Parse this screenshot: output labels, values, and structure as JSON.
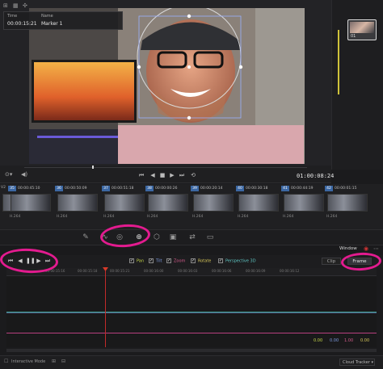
{
  "viewer": {
    "info_time_label": "Time",
    "info_time_value": "00:00:15:21",
    "info_name_label": "Name",
    "info_name_value": "Marker 1",
    "timecode": "01:00:08:24"
  },
  "node": {
    "label": "01"
  },
  "clips": [
    {
      "num": "35",
      "tc": "00:00:45:10",
      "codec": "H.264"
    },
    {
      "num": "36",
      "tc": "00:00:50:09",
      "codec": "H.264"
    },
    {
      "num": "37",
      "tc": "00:00:51:18",
      "codec": "H.264"
    },
    {
      "num": "38",
      "tc": "00:00:00:26",
      "codec": "H.264"
    },
    {
      "num": "39",
      "tc": "00:00:20:14",
      "codec": "H.264"
    },
    {
      "num": "40",
      "tc": "00:00:30:18",
      "codec": "H.264"
    },
    {
      "num": "41",
      "tc": "00:00:44:19",
      "codec": "H.264"
    },
    {
      "num": "42",
      "tc": "00:00:01:15",
      "codec": "H.264"
    }
  ],
  "tracker": {
    "window_label": "Window",
    "checks": [
      "Pan",
      "Tilt",
      "Zoom",
      "Rotate",
      "Perspective 3D"
    ],
    "clip_label": "Clip",
    "frame_label": "Frame",
    "ruler_ticks": [
      "00:00:15:16",
      "00:00:15:18",
      "00:00:15:21",
      "00:00:16:00",
      "00:00:16:03",
      "00:00:16:06",
      "00:00:16:09",
      "00:00:16:12"
    ],
    "values": [
      "0.00",
      "0.00",
      "1.00",
      "0.00"
    ]
  },
  "bottom": {
    "interactive_mode": "Interactive Mode",
    "cloud_tracker": "Cloud Tracker"
  },
  "colors": {
    "annotation": "#e31b8f",
    "accent": "#3b67a3",
    "playhead": "#c22a2a"
  }
}
